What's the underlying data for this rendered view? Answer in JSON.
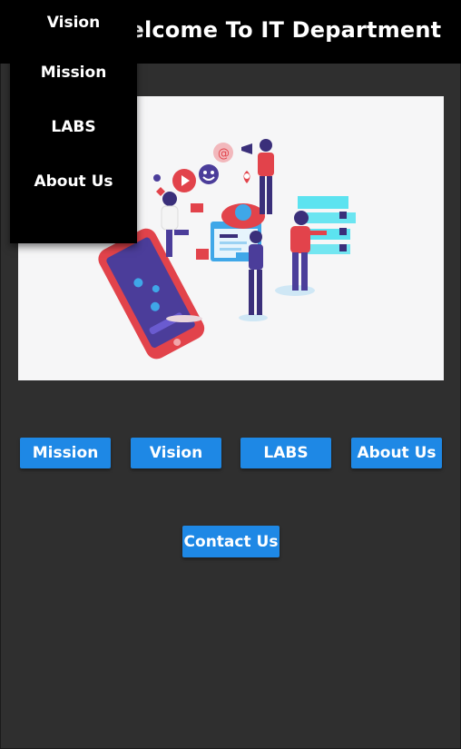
{
  "header": {
    "title": "Welcome To IT Department"
  },
  "dropdown": {
    "items": [
      {
        "label": "Vision"
      },
      {
        "label": "Mission"
      },
      {
        "label": "LABS"
      },
      {
        "label": "About Us"
      }
    ]
  },
  "nav_buttons": {
    "mission": "Mission",
    "vision": "Vision",
    "labs": "LABS",
    "about": "About Us",
    "contact": "Contact Us"
  },
  "colors": {
    "header_bg": "#000000",
    "page_bg": "#2f2f2f",
    "button_bg": "#1e88e5",
    "button_text": "#ffffff"
  }
}
